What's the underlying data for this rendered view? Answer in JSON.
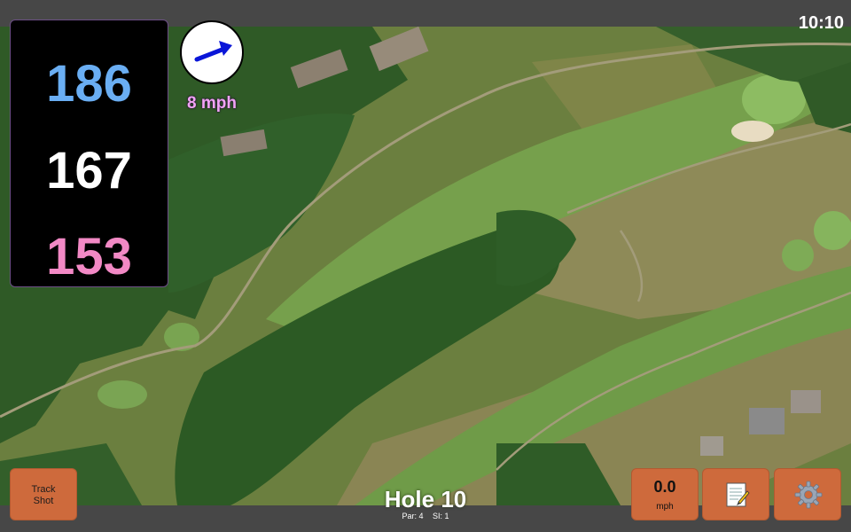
{
  "status_bar": {
    "time": "10:10"
  },
  "distances": {
    "back": "186",
    "middle": "167",
    "front": "153",
    "colors": {
      "back": "#6aaef3",
      "middle": "#ffffff",
      "front": "#f289c5"
    }
  },
  "wind": {
    "speed": "8 mph",
    "icon": "wind-arrow-icon"
  },
  "track_shot": {
    "label": "Track\nShot"
  },
  "hole": {
    "title": "Hole 10",
    "par": "Par: 4",
    "si": "SI: 1"
  },
  "speed": {
    "value": "0.0",
    "unit": "mph"
  },
  "buttons": {
    "notes_icon": "notepad-icon",
    "settings_icon": "gear-icon"
  },
  "accent": "#ce6a3c"
}
